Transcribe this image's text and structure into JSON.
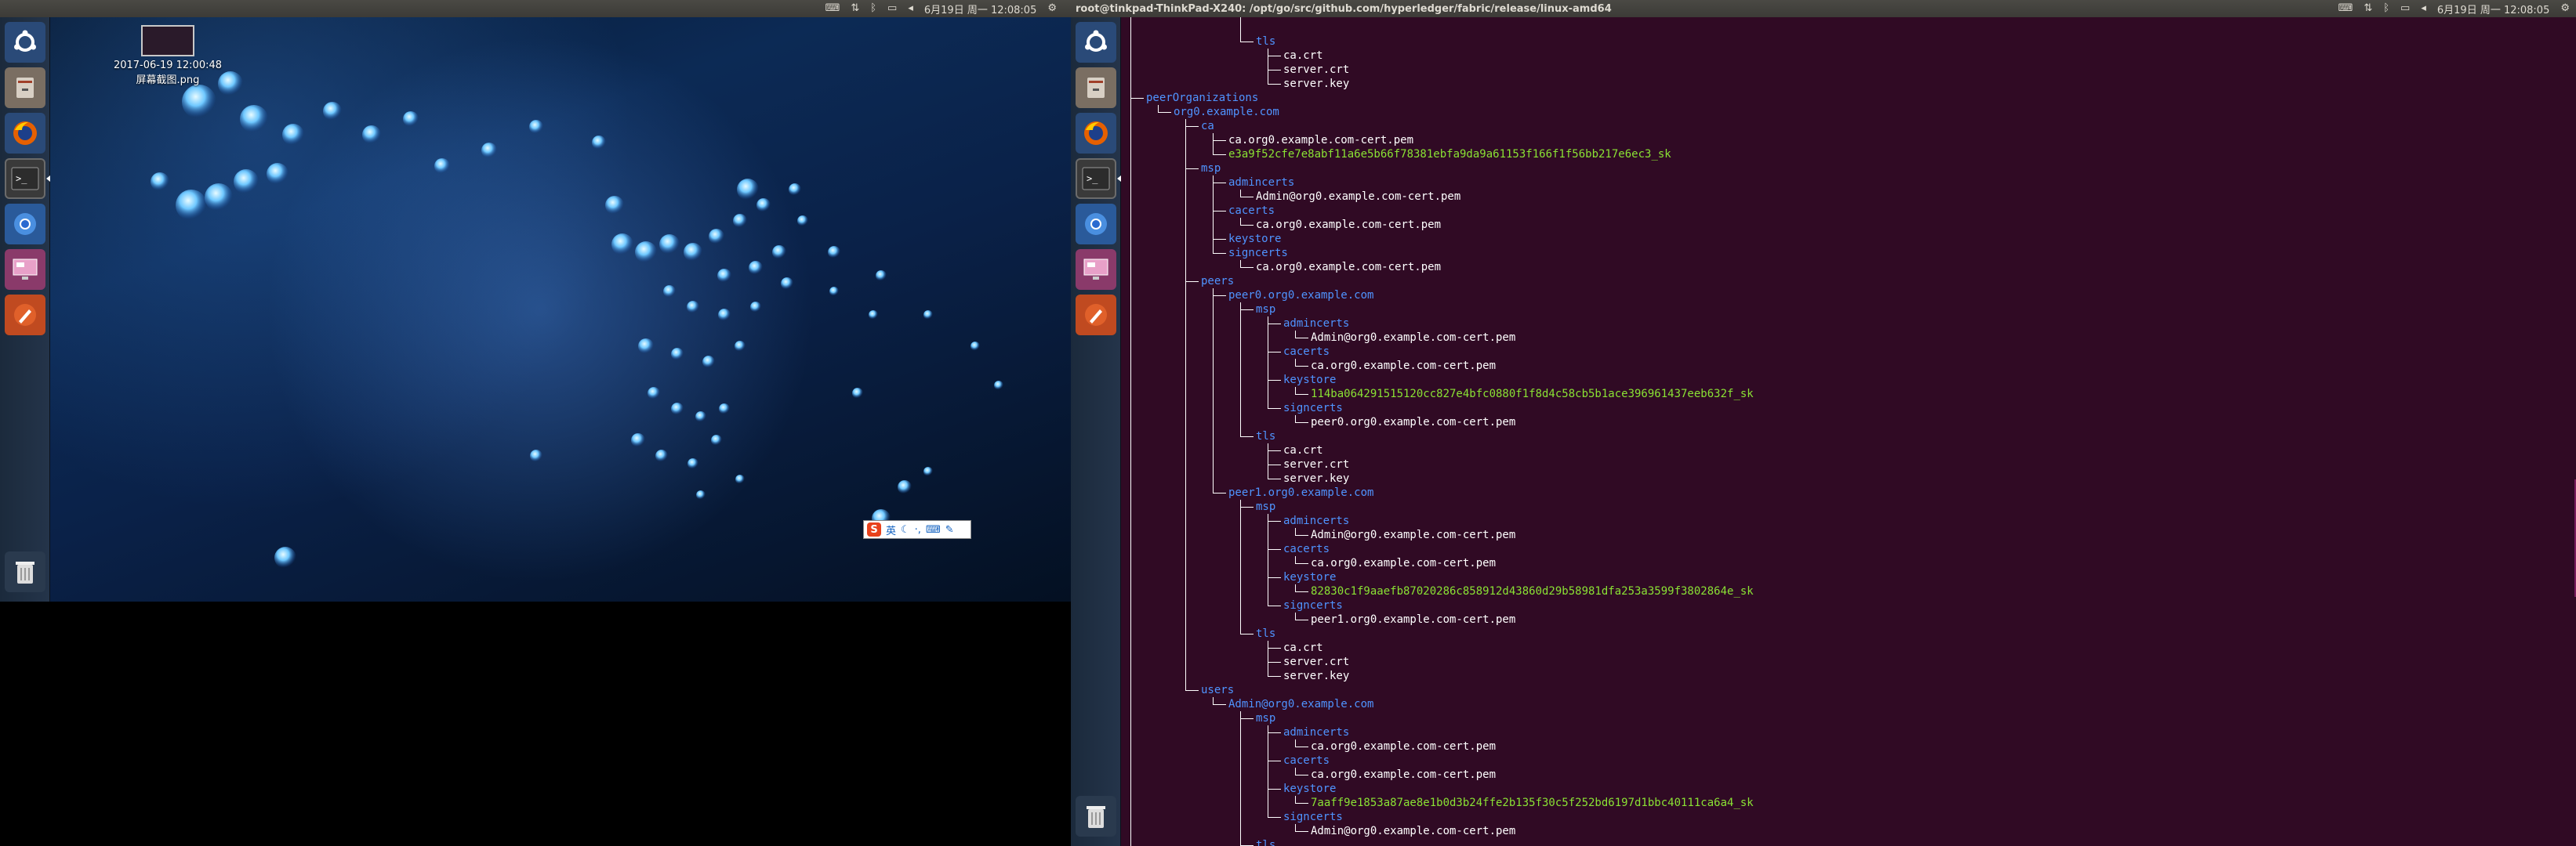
{
  "left_screen": {
    "topbar": {
      "date": "6月19日 周一 12:08:05"
    },
    "desktop_icon": {
      "label_line1": "2017-06-19 12:00:48",
      "label_line2": "屏幕截图.png"
    },
    "ime_bar": {
      "logo": "S",
      "mode": "英"
    }
  },
  "right_screen": {
    "topbar": {
      "title": "root@tinkpad-ThinkPad-X240: /opt/go/src/github.com/hyperledger/fabric/release/linux-amd64",
      "date": "6月19日 周一 12:08:05"
    }
  },
  "launcher_items": [
    "ubuntu-dash",
    "files",
    "firefox",
    "terminal",
    "chromium",
    "remote-desktop",
    "draw-tool"
  ],
  "colors": {
    "terminal_bg": "#300a24",
    "dir": "#4f94ff",
    "file": "#ffffff",
    "key": "#8ae234",
    "panel": "#3c3b37"
  },
  "terminal": {
    "lines": [
      {
        "depth": 5,
        "t": "tls",
        "c": "d"
      },
      {
        "depth": 6,
        "t": "ca.crt",
        "c": "f"
      },
      {
        "depth": 6,
        "t": "server.crt",
        "c": "f"
      },
      {
        "depth": 6,
        "t": "server.key",
        "c": "f"
      },
      {
        "depth": 1,
        "t": "peerOrganizations",
        "c": "d"
      },
      {
        "depth": 2,
        "t": "org0.example.com",
        "c": "d"
      },
      {
        "depth": 3,
        "t": "ca",
        "c": "d"
      },
      {
        "depth": 4,
        "t": "ca.org0.example.com-cert.pem",
        "c": "f"
      },
      {
        "depth": 4,
        "t": "e3a9f52cfe7e8abf11a6e5b66f78381ebfa9da9a61153f166f1f56bb217e6ec3_sk",
        "c": "k"
      },
      {
        "depth": 3,
        "t": "msp",
        "c": "d"
      },
      {
        "depth": 4,
        "t": "admincerts",
        "c": "d"
      },
      {
        "depth": 5,
        "t": "Admin@org0.example.com-cert.pem",
        "c": "f"
      },
      {
        "depth": 4,
        "t": "cacerts",
        "c": "d"
      },
      {
        "depth": 5,
        "t": "ca.org0.example.com-cert.pem",
        "c": "f"
      },
      {
        "depth": 4,
        "t": "keystore",
        "c": "d"
      },
      {
        "depth": 4,
        "t": "signcerts",
        "c": "d"
      },
      {
        "depth": 5,
        "t": "ca.org0.example.com-cert.pem",
        "c": "f"
      },
      {
        "depth": 3,
        "t": "peers",
        "c": "d"
      },
      {
        "depth": 4,
        "t": "peer0.org0.example.com",
        "c": "d"
      },
      {
        "depth": 5,
        "t": "msp",
        "c": "d"
      },
      {
        "depth": 6,
        "t": "admincerts",
        "c": "d"
      },
      {
        "depth": 7,
        "t": "Admin@org0.example.com-cert.pem",
        "c": "f"
      },
      {
        "depth": 6,
        "t": "cacerts",
        "c": "d"
      },
      {
        "depth": 7,
        "t": "ca.org0.example.com-cert.pem",
        "c": "f"
      },
      {
        "depth": 6,
        "t": "keystore",
        "c": "d"
      },
      {
        "depth": 7,
        "t": "114ba064291515120cc827e4bfc0880f1f8d4c58cb5b1ace396961437eeb632f_sk",
        "c": "k"
      },
      {
        "depth": 6,
        "t": "signcerts",
        "c": "d"
      },
      {
        "depth": 7,
        "t": "peer0.org0.example.com-cert.pem",
        "c": "f"
      },
      {
        "depth": 5,
        "t": "tls",
        "c": "d"
      },
      {
        "depth": 6,
        "t": "ca.crt",
        "c": "f"
      },
      {
        "depth": 6,
        "t": "server.crt",
        "c": "f"
      },
      {
        "depth": 6,
        "t": "server.key",
        "c": "f"
      },
      {
        "depth": 4,
        "t": "peer1.org0.example.com",
        "c": "d"
      },
      {
        "depth": 5,
        "t": "msp",
        "c": "d"
      },
      {
        "depth": 6,
        "t": "admincerts",
        "c": "d"
      },
      {
        "depth": 7,
        "t": "Admin@org0.example.com-cert.pem",
        "c": "f"
      },
      {
        "depth": 6,
        "t": "cacerts",
        "c": "d"
      },
      {
        "depth": 7,
        "t": "ca.org0.example.com-cert.pem",
        "c": "f"
      },
      {
        "depth": 6,
        "t": "keystore",
        "c": "d"
      },
      {
        "depth": 7,
        "t": "82830c1f9aaefb87020286c858912d43860d29b58981dfa253a3599f3802864e_sk",
        "c": "k"
      },
      {
        "depth": 6,
        "t": "signcerts",
        "c": "d"
      },
      {
        "depth": 7,
        "t": "peer1.org0.example.com-cert.pem",
        "c": "f"
      },
      {
        "depth": 5,
        "t": "tls",
        "c": "d"
      },
      {
        "depth": 6,
        "t": "ca.crt",
        "c": "f"
      },
      {
        "depth": 6,
        "t": "server.crt",
        "c": "f"
      },
      {
        "depth": 6,
        "t": "server.key",
        "c": "f"
      },
      {
        "depth": 3,
        "t": "users",
        "c": "d"
      },
      {
        "depth": 4,
        "t": "Admin@org0.example.com",
        "c": "d"
      },
      {
        "depth": 5,
        "t": "msp",
        "c": "d"
      },
      {
        "depth": 6,
        "t": "admincerts",
        "c": "d"
      },
      {
        "depth": 7,
        "t": "ca.org0.example.com-cert.pem",
        "c": "f"
      },
      {
        "depth": 6,
        "t": "cacerts",
        "c": "d"
      },
      {
        "depth": 7,
        "t": "ca.org0.example.com-cert.pem",
        "c": "f"
      },
      {
        "depth": 6,
        "t": "keystore",
        "c": "d"
      },
      {
        "depth": 7,
        "t": "7aaff9e1853a87ae8e1b0d3b24ffe2b135f30c5f252bd6197d1bbc40111ca6a4_sk",
        "c": "k"
      },
      {
        "depth": 6,
        "t": "signcerts",
        "c": "d"
      },
      {
        "depth": 7,
        "t": "Admin@org0.example.com-cert.pem",
        "c": "f"
      },
      {
        "depth": 5,
        "t": "tls",
        "c": "d"
      }
    ]
  }
}
